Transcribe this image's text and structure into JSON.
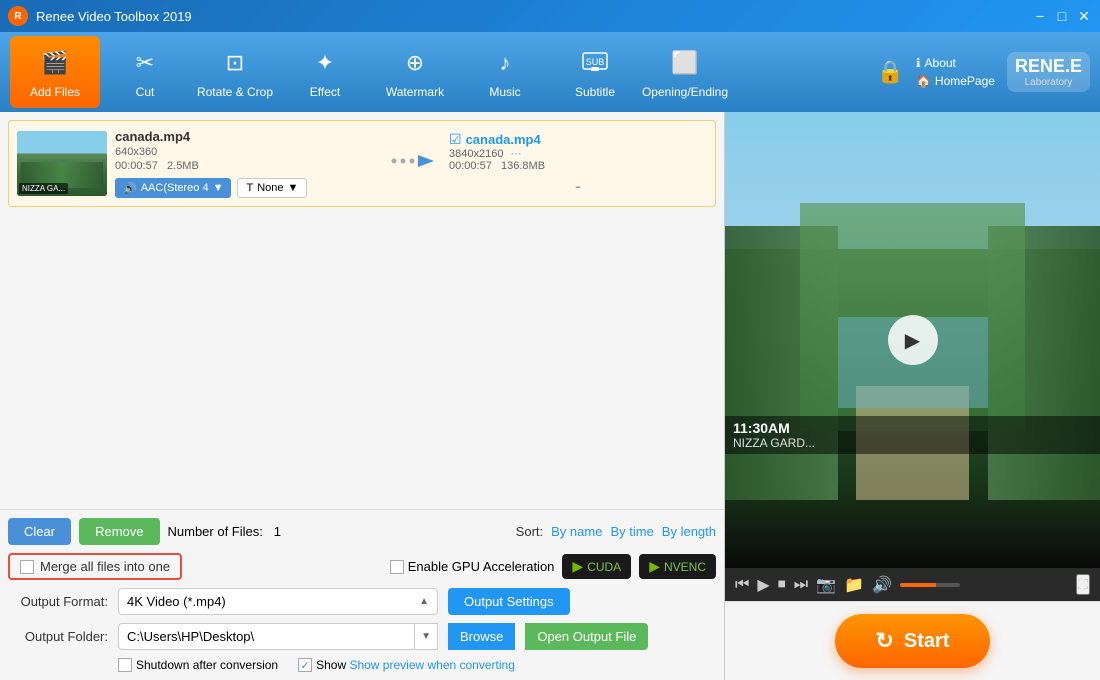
{
  "app": {
    "title": "Renee Video Toolbox 2019",
    "logo": "▶"
  },
  "toolbar": {
    "items": [
      {
        "id": "add-files",
        "label": "Add Files",
        "icon": "🎬"
      },
      {
        "id": "cut",
        "label": "Cut",
        "icon": "✂"
      },
      {
        "id": "rotate-crop",
        "label": "Rotate & Crop",
        "icon": "⊡"
      },
      {
        "id": "effect",
        "label": "Effect",
        "icon": "✦"
      },
      {
        "id": "watermark",
        "label": "Watermark",
        "icon": "⊕"
      },
      {
        "id": "music",
        "label": "Music",
        "icon": "♪"
      },
      {
        "id": "subtitle",
        "label": "Subtitle",
        "icon": "⊡"
      },
      {
        "id": "opening-ending",
        "label": "Opening/Ending",
        "icon": "⬜"
      }
    ],
    "about_label": "About",
    "homepage_label": "HomePage"
  },
  "file_list": {
    "file": {
      "name": "canada.mp4",
      "resolution": "640x360",
      "duration": "00:00:57",
      "size": "2.5MB",
      "audio": "AAC(Stereo 4",
      "subtitle": "None",
      "output_name": "canada.mp4",
      "output_resolution": "3840x2160",
      "output_duration": "00:00:57",
      "output_size": "136.8MB"
    }
  },
  "controls": {
    "clear_label": "Clear",
    "remove_label": "Remove",
    "file_count_label": "Number of Files:",
    "file_count": "1",
    "sort_label": "Sort:",
    "sort_by_name": "By name",
    "sort_by_time": "By time",
    "sort_by_length": "By length"
  },
  "merge": {
    "label": "Merge all files into one",
    "gpu_label": "Enable GPU Acceleration",
    "cuda_label": "CUDA",
    "nvenc_label": "NVENC"
  },
  "output": {
    "format_label": "Output Format:",
    "format_value": "4K Video (*.mp4)",
    "settings_label": "Output Settings",
    "folder_label": "Output Folder:",
    "folder_path": "C:\\Users\\HP\\Desktop\\",
    "browse_label": "Browse",
    "open_output_label": "Open Output File"
  },
  "options": {
    "shutdown_label": "Shutdown after conversion",
    "preview_label": "Show preview when converting"
  },
  "video_preview": {
    "time": "11:30AM",
    "location": "NIZZA GARD..."
  },
  "start": {
    "label": "Start"
  }
}
